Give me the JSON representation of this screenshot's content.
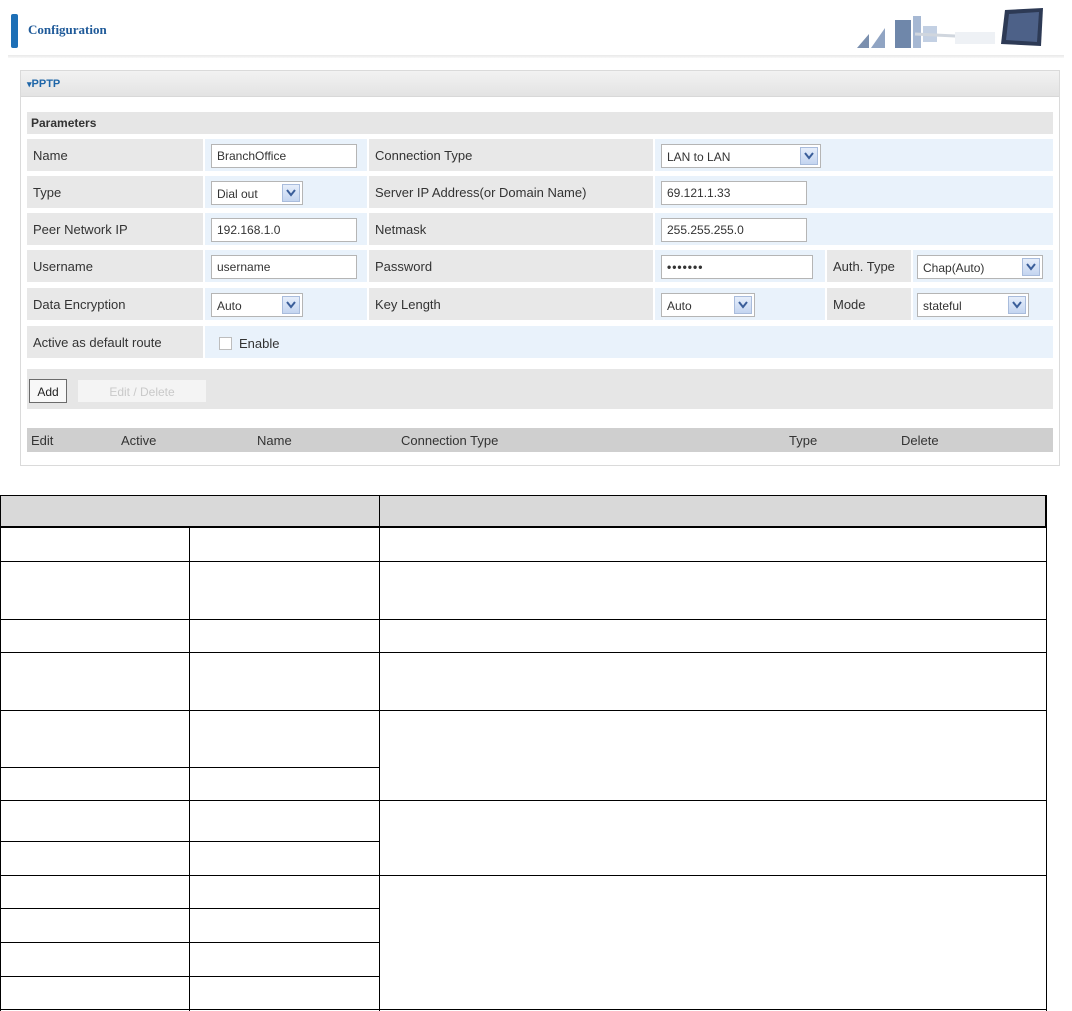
{
  "header": {
    "title": "Configuration"
  },
  "section": {
    "title": "PPTP",
    "params_title": "Parameters"
  },
  "form": {
    "name_label": "Name",
    "name_value": "BranchOffice",
    "conn_type_label": "Connection Type",
    "conn_type_value": "LAN to LAN",
    "type_label": "Type",
    "type_value": "Dial out",
    "server_label": "Server IP Address(or Domain Name)",
    "server_value": "69.121.1.33",
    "peer_label": "Peer Network IP",
    "peer_value": "192.168.1.0",
    "netmask_label": "Netmask",
    "netmask_value": "255.255.255.0",
    "username_label": "Username",
    "username_value": "username",
    "password_label": "Password",
    "password_value": "•••••••",
    "auth_label": "Auth. Type",
    "auth_value": "Chap(Auto)",
    "enc_label": "Data Encryption",
    "enc_value": "Auto",
    "keylen_label": "Key Length",
    "keylen_value": "Auto",
    "mode_label": "Mode",
    "mode_value": "stateful",
    "default_route_label": "Active as default route",
    "enable_label": "Enable"
  },
  "buttons": {
    "add": "Add",
    "edit_delete": "Edit / Delete"
  },
  "list": {
    "columns": [
      "Edit",
      "Active",
      "Name",
      "Connection Type",
      "Type",
      "Delete"
    ]
  },
  "colors": {
    "accent": "#1d6fb6",
    "value_bg": "#e9f2fb",
    "label_bg": "#e8e8e8"
  }
}
